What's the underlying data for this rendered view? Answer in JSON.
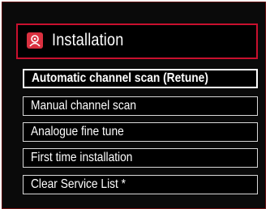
{
  "header": {
    "title": "Installation",
    "icon": "installation-icon",
    "accent_color": "#c8102e"
  },
  "menu": {
    "items": [
      {
        "label": "Automatic channel scan (Retune)",
        "selected": true
      },
      {
        "label": "Manual channel scan",
        "selected": false
      },
      {
        "label": "Analogue fine tune",
        "selected": false
      },
      {
        "label": "First time installation",
        "selected": false
      },
      {
        "label": "Clear Service List *",
        "selected": false
      }
    ]
  }
}
